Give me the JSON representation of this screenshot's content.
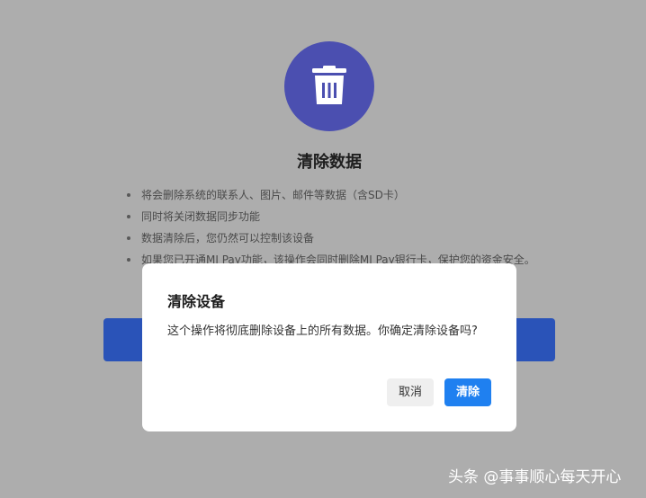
{
  "page": {
    "title": "清除数据",
    "bullets": [
      "将会删除系统的联系人、图片、邮件等数据（含SD卡）",
      "同时将关闭数据同步功能",
      "数据清除后，您仍然可以控制该设备",
      "如果您已开通MI Pay功能，该操作会同时删除MI Pay银行卡，保护您的资金安全。"
    ],
    "icon": "trash-icon",
    "icon_bg_color": "#4b4fb0",
    "button_color": "#2a53b8"
  },
  "dialog": {
    "title": "清除设备",
    "message": "这个操作将彻底删除设备上的所有数据。你确定清除设备吗?",
    "cancel_label": "取消",
    "confirm_label": "清除",
    "confirm_color": "#1f80f0"
  },
  "watermark": "头条 @事事顺心每天开心"
}
